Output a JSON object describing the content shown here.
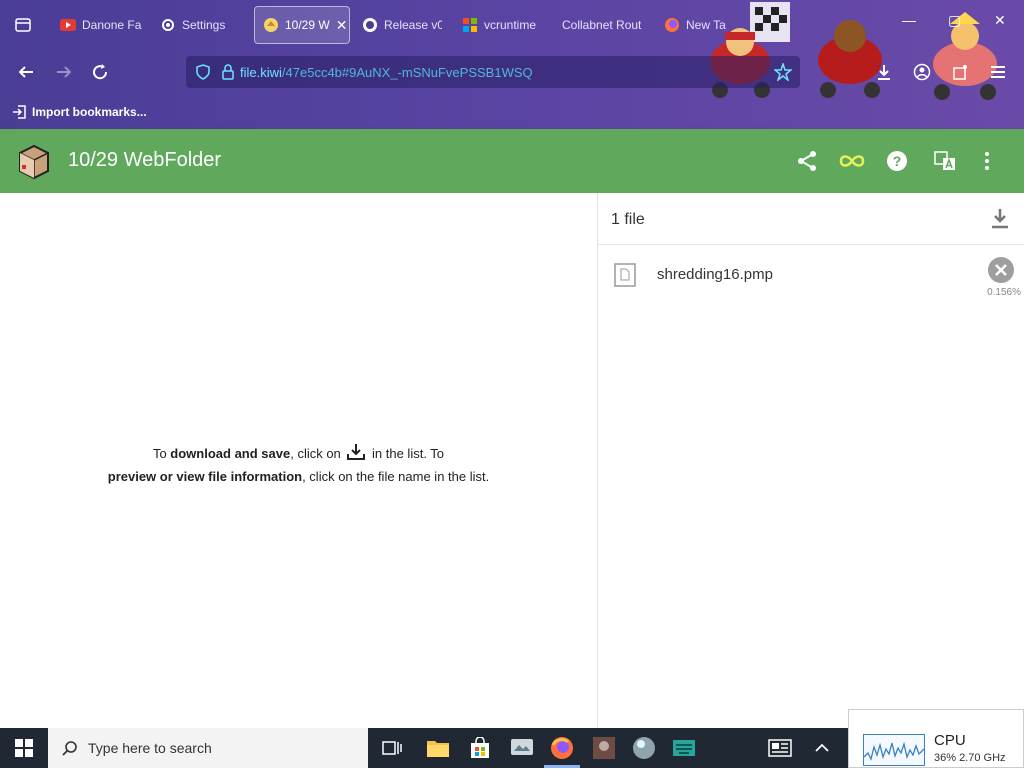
{
  "browser": {
    "tabs": [
      {
        "label": "Danone Fa",
        "icon": "youtube-icon"
      },
      {
        "label": "Settings",
        "icon": "gear-icon"
      },
      {
        "label": "10/29 W",
        "icon": "webfolder-icon",
        "active": true
      },
      {
        "label": "Release v0",
        "icon": "github-icon"
      },
      {
        "label": "vcruntime",
        "icon": "microsoft-icon"
      },
      {
        "label": "Collabnet Rout",
        "icon": "page-icon"
      },
      {
        "label": "New Ta",
        "icon": "firefox-icon"
      }
    ],
    "url_host": "file.kiwi",
    "url_path": "/47e5cc4b#9AuNX_-mSNuFvePSSB1WSQ",
    "bookmarks_label": "Import bookmarks..."
  },
  "app": {
    "title": "10/29 WebFolder",
    "accent": "#5fa85c"
  },
  "instructions": {
    "line1_prefix": "To ",
    "line1_bold": "download and save",
    "line1_mid": ", click on ",
    "line1_suffix": " in the list. To",
    "line2_bold": "preview or view file information",
    "line2_suffix": ", click on the file name in the list."
  },
  "files_panel": {
    "count_label": "1 file",
    "files": [
      {
        "name": "shredding16.pmp",
        "progress": "0.156%"
      }
    ]
  },
  "taskbar": {
    "search_placeholder": "Type here to search"
  },
  "cpu_widget": {
    "title": "CPU",
    "value": "36%  2.70 GHz"
  }
}
